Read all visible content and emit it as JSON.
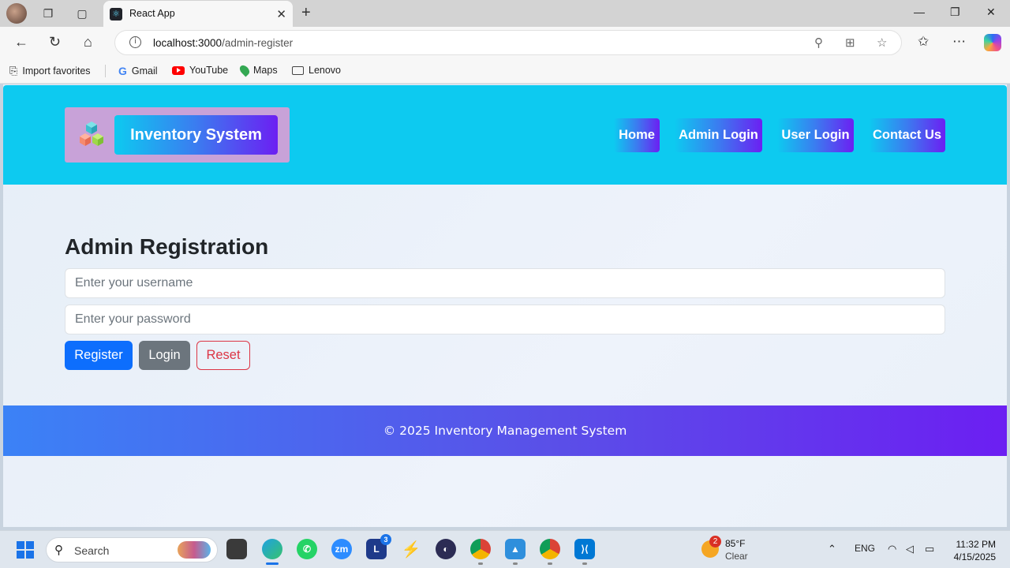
{
  "browser": {
    "tab_title": "React App",
    "url_host": "localhost:3000",
    "url_path": "/admin-register",
    "bookmarks": [
      "Import favorites",
      "Gmail",
      "YouTube",
      "Maps",
      "Lenovo"
    ]
  },
  "app": {
    "brand": "Inventory System",
    "nav": [
      "Home",
      "Admin Login",
      "User Login",
      "Contact Us"
    ],
    "colors": {
      "header": "#0dcaf0",
      "gradient_start": "#0dcaf0",
      "gradient_end": "#6c1ff2",
      "primary": "#0d6efd",
      "secondary": "#6c757d",
      "danger": "#dc3545"
    }
  },
  "form": {
    "title": "Admin Registration",
    "username_placeholder": "Enter your username",
    "password_placeholder": "Enter your password",
    "username_value": "",
    "password_value": "",
    "register_label": "Register",
    "login_label": "Login",
    "reset_label": "Reset"
  },
  "footer": {
    "text": "© 2025 Inventory Management System"
  },
  "taskbar": {
    "search_label": "Search",
    "badge_count": "3",
    "weather_badge": "2",
    "weather_temp": "85°F",
    "weather_cond": "Clear",
    "lang": "ENG",
    "time": "11:32 PM",
    "date": "4/15/2025"
  }
}
